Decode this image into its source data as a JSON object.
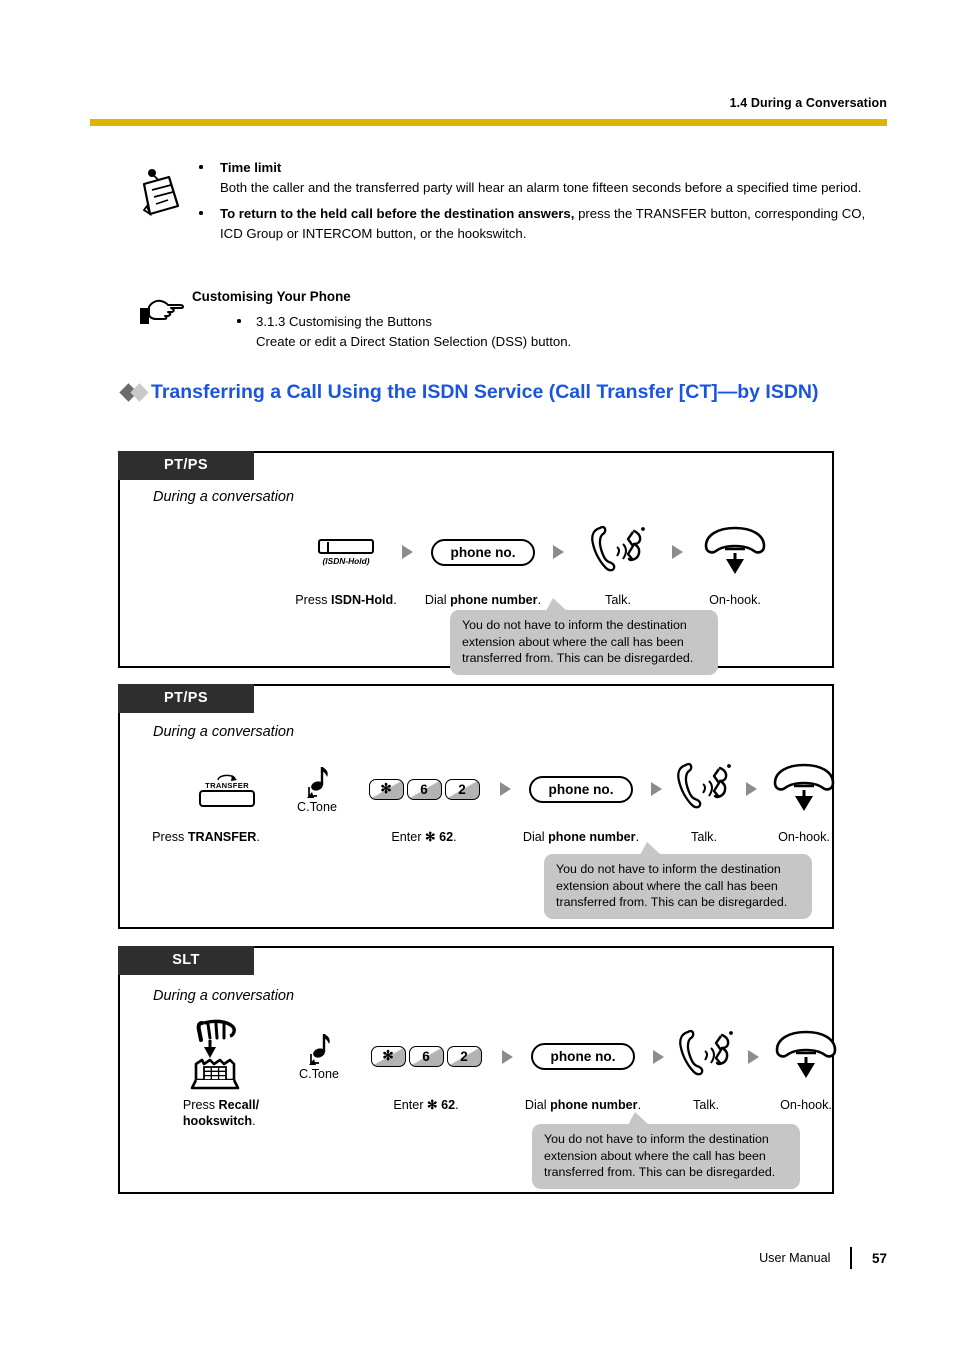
{
  "header": {
    "section_title": "1.4 During a Conversation",
    "rule_color": "#dfb300"
  },
  "notes": {
    "items": [
      {
        "bold_lead": "Time limit",
        "body": "Both the caller and the transferred party will hear an alarm tone fifteen seconds before a specified time period."
      },
      {
        "bold_lead": "To return to the held call before the destination answers,",
        "body": " press the TRANSFER button, corresponding CO, ICD Group or INTERCOM button, or the hookswitch."
      }
    ]
  },
  "customising": {
    "title": "Customising Your Phone",
    "items": [
      {
        "line1": "3.1.3 Customising the Buttons",
        "line2": "Create or edit a Direct Station Selection (DSS) button."
      }
    ]
  },
  "section": {
    "heading": "Transferring a Call Using the ISDN Service (Call Transfer [CT]—by ISDN)",
    "heading_color": "#1a55e0"
  },
  "procedures": [
    {
      "tag": "PT/PS",
      "subtitle": "During a conversation",
      "steps": [
        {
          "art": "isdn-hold-button",
          "art_label": "(ISDN-Hold)",
          "caption_plain": "Press ",
          "caption_bold": "ISDN-Hold",
          "caption_tail": "."
        },
        {
          "art": "phone-no-pill",
          "art_label": "phone no.",
          "caption_plain": "Dial ",
          "caption_bold": "phone number",
          "caption_tail": "."
        },
        {
          "art": "talk-handset",
          "art_label": "",
          "caption_plain": "Talk.",
          "caption_bold": "",
          "caption_tail": ""
        },
        {
          "art": "on-hook-handset",
          "art_label": "",
          "caption_plain": "On-hook.",
          "caption_bold": "",
          "caption_tail": ""
        }
      ],
      "callout": "You do not have to inform the destination extension about where the call has been transferred from. This can be disregarded."
    },
    {
      "tag": "PT/PS",
      "subtitle": "During a conversation",
      "steps": [
        {
          "art": "transfer-button",
          "art_label": "TRANSFER",
          "caption_plain": "Press ",
          "caption_bold": "TRANSFER",
          "caption_tail": "."
        },
        {
          "art": "c-tone",
          "art_label": "C.Tone",
          "caption_plain": "",
          "caption_bold": "",
          "caption_tail": ""
        },
        {
          "art": "keypad",
          "keys": [
            "✻",
            "6",
            "2"
          ],
          "caption_plain": "Enter ",
          "caption_bold": "✻ 62",
          "caption_tail": "."
        },
        {
          "art": "phone-no-pill",
          "art_label": "phone no.",
          "caption_plain": "Dial ",
          "caption_bold": "phone number",
          "caption_tail": "."
        },
        {
          "art": "talk-handset",
          "art_label": "",
          "caption_plain": "Talk.",
          "caption_bold": "",
          "caption_tail": ""
        },
        {
          "art": "on-hook-handset",
          "art_label": "",
          "caption_plain": "On-hook.",
          "caption_bold": "",
          "caption_tail": ""
        }
      ],
      "callout": "You do not have to inform the destination extension about where the call has been transferred from. This can be disregarded."
    },
    {
      "tag": "SLT",
      "subtitle": "During a conversation",
      "steps": [
        {
          "art": "recall-hookswitch",
          "art_label": "",
          "caption_plain": "Press ",
          "caption_bold": "Recall/",
          "caption_bold2": "hookswitch",
          "caption_tail": "."
        },
        {
          "art": "c-tone",
          "art_label": "C.Tone",
          "caption_plain": "",
          "caption_bold": "",
          "caption_tail": ""
        },
        {
          "art": "keypad",
          "keys": [
            "✻",
            "6",
            "2"
          ],
          "caption_plain": "Enter ",
          "caption_bold": "✻ 62",
          "caption_tail": "."
        },
        {
          "art": "phone-no-pill",
          "art_label": "phone no.",
          "caption_plain": "Dial ",
          "caption_bold": "phone number",
          "caption_tail": "."
        },
        {
          "art": "talk-handset",
          "art_label": "",
          "caption_plain": "Talk.",
          "caption_bold": "",
          "caption_tail": ""
        },
        {
          "art": "on-hook-handset",
          "art_label": "",
          "caption_plain": "On-hook.",
          "caption_bold": "",
          "caption_tail": ""
        }
      ],
      "callout": "You do not have to inform the destination extension about where the call has been transferred from. This can be disregarded."
    }
  ],
  "footer": {
    "manual_label": "User Manual",
    "page_number": "57"
  }
}
